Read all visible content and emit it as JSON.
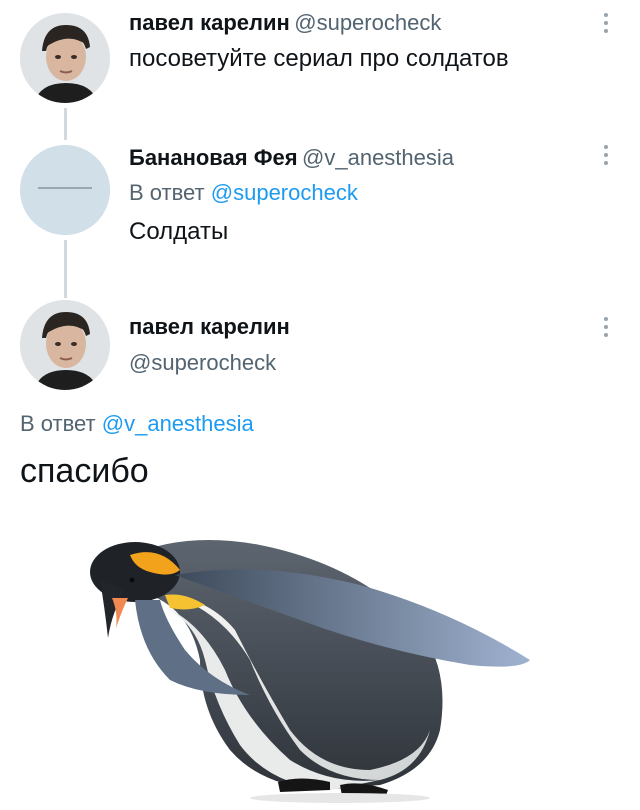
{
  "tweets": [
    {
      "name": "павел карелин",
      "handle": "@superocheck",
      "text": "посоветуйте сериал про солдатов"
    },
    {
      "name": "Банановая Фея",
      "handle": "@v_anesthesia",
      "reply_prefix": "В ответ",
      "reply_to": "@superocheck",
      "text": "Солдаты"
    },
    {
      "name": "павел карелин",
      "handle": "@superocheck",
      "reply_prefix": "В ответ",
      "reply_to": "@v_anesthesia",
      "text": "спасибо"
    }
  ],
  "icons": {
    "more": "more-vertical-icon",
    "avatar": "avatar",
    "media": "penguin-bow-image"
  },
  "colors": {
    "link": "#1d9bf0",
    "muted": "#536471",
    "thread_line": "#cfd9de"
  }
}
